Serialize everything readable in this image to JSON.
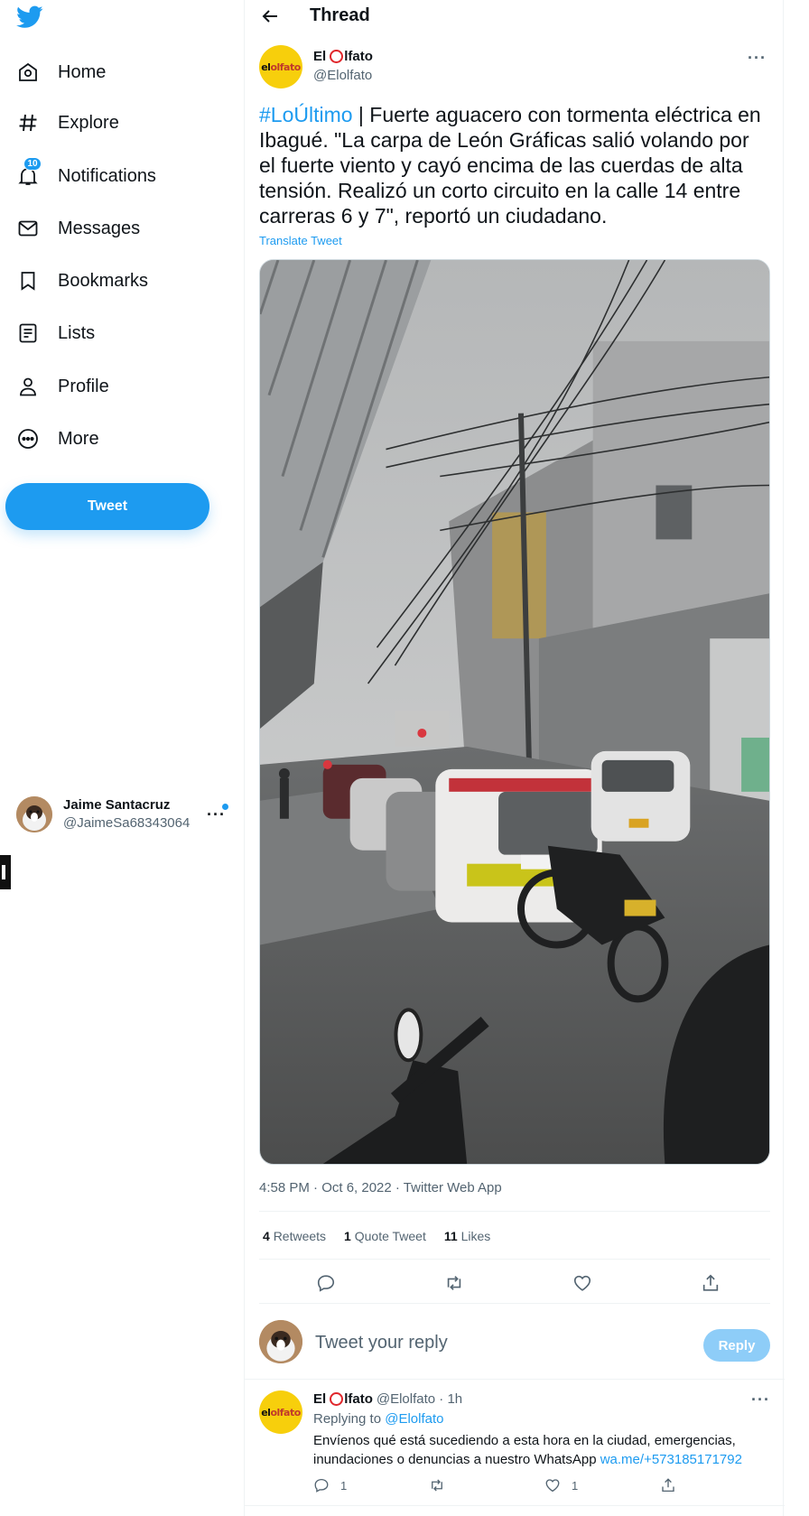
{
  "sidebar": {
    "logo": "twitter-bird-icon",
    "items": [
      {
        "label": "Home",
        "icon": "home-icon"
      },
      {
        "label": "Explore",
        "icon": "hashtag-icon"
      },
      {
        "label": "Notifications",
        "icon": "bell-icon",
        "badge": "10"
      },
      {
        "label": "Messages",
        "icon": "envelope-icon"
      },
      {
        "label": "Bookmarks",
        "icon": "bookmark-icon"
      },
      {
        "label": "Lists",
        "icon": "list-icon"
      },
      {
        "label": "Profile",
        "icon": "person-icon"
      },
      {
        "label": "More",
        "icon": "more-circle-icon"
      }
    ],
    "tweet_button": "Tweet",
    "account": {
      "name": "Jaime Santacruz",
      "handle": "@JaimeSa68343064",
      "more": "···"
    }
  },
  "header": {
    "title": "Thread"
  },
  "tweet": {
    "author_name_pre": "El ",
    "author_name_post": "lfato",
    "author_handle": "@Elolfato",
    "hashtag": "#LoÚltimo",
    "text": " | Fuerte aguacero con tormenta eléctrica en Ibagué. \"La carpa de León Gráficas salió volando por el fuerte viento y cayó encima de las cuerdas de alta tensión. Realizó un corto circuito en la calle 14 entre carreras 6 y 7\", reportó un ciudadano.",
    "translate": "Translate Tweet",
    "timestamp": "4:58 PM · Oct 6, 2022 · Twitter Web App",
    "stats": {
      "retweets": "4",
      "retweets_label": "Retweets",
      "quotes": "1",
      "quotes_label": "Quote Tweet",
      "likes": "11",
      "likes_label": "Likes"
    },
    "brand_logo": {
      "a": "el",
      "b": "olfato"
    }
  },
  "reply_box": {
    "placeholder": "Tweet your reply",
    "button": "Reply"
  },
  "reply": {
    "name_pre": "El ",
    "name_post": "lfato",
    "meta": "@Elolfato · 1h",
    "replying_label": "Replying to",
    "replying_handle": "@Elolfato",
    "body": "Envíenos qué está sucediendo a esta hora en la ciudad,  emergencias, inundaciones o denuncias a nuestro WhatsApp ",
    "link": "wa.me/+573185171792",
    "reply_count": "1",
    "like_count": "1"
  },
  "colors": {
    "accent": "#1d9bf0",
    "text": "#0f1419",
    "muted": "#536471",
    "brand_yellow": "#f7cf0c",
    "brand_red": "#e0262b"
  }
}
